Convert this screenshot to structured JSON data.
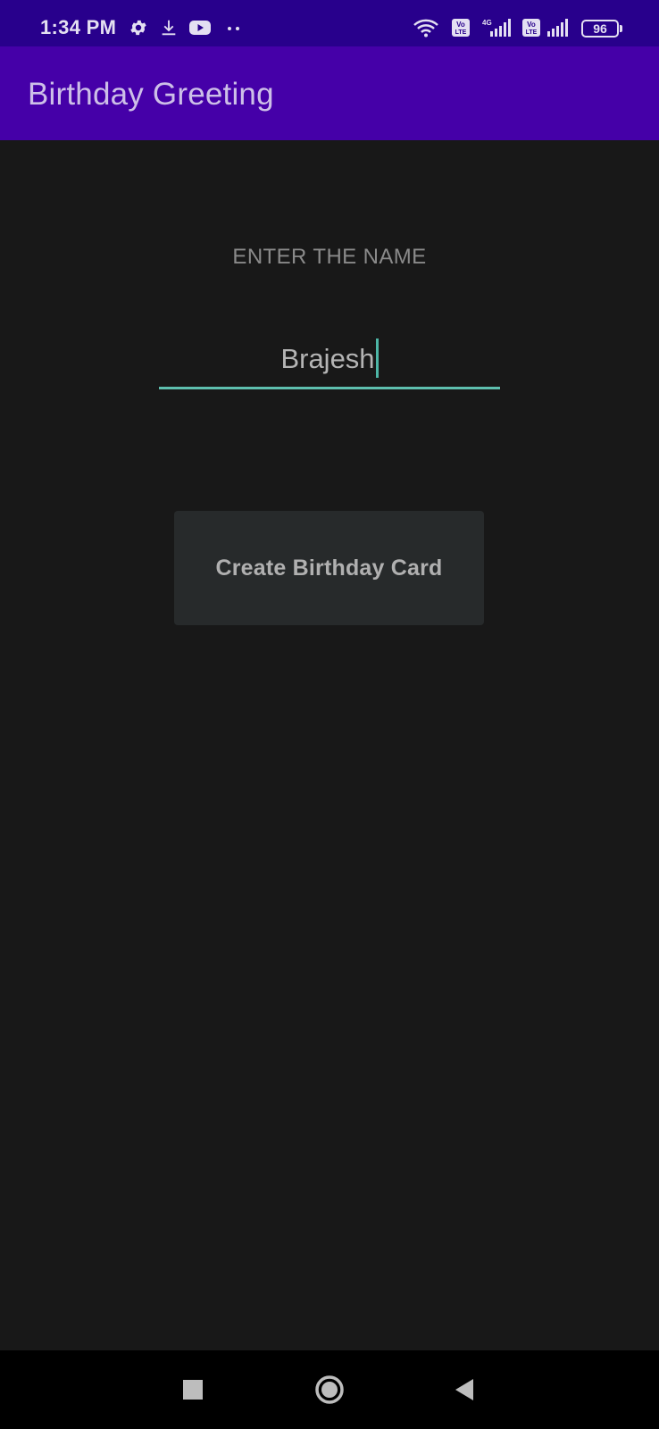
{
  "status_bar": {
    "time": "1:34 PM",
    "icons": [
      "settings-icon",
      "download-icon",
      "youtube-icon",
      "more-dots-icon",
      "wifi-icon",
      "volte-icon",
      "signal-4g-icon",
      "volte-icon",
      "signal-icon"
    ],
    "battery": "96"
  },
  "app_bar": {
    "title": "Birthday Greeting"
  },
  "form": {
    "prompt": "ENTER THE NAME",
    "name_value": "Brajesh",
    "button_label": "Create Birthday Card"
  },
  "nav_bar": {
    "icons": [
      "recents-icon",
      "home-icon",
      "back-icon"
    ]
  },
  "colors": {
    "status_bar": "#28008c",
    "app_bar": "#4500a8",
    "background": "#181818",
    "accent": "#5ebfae",
    "button": "#272a2b"
  }
}
